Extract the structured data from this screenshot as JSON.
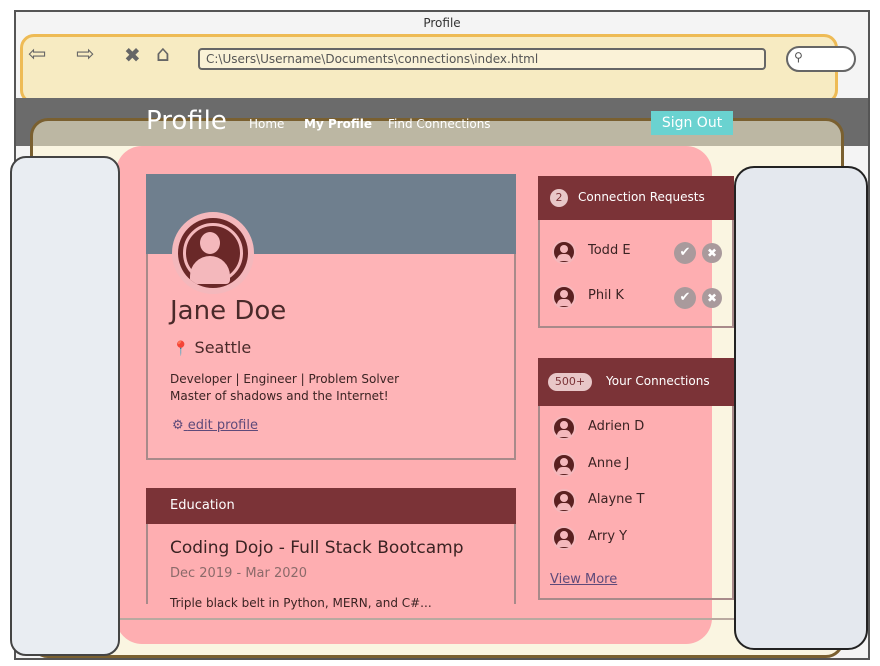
{
  "window": {
    "title": "Profile"
  },
  "browser": {
    "url": "C:\\Users\\Username\\Documents\\connections\\index.html",
    "search_icon": "magnifier-icon"
  },
  "navbar": {
    "brand": "Profile",
    "links": [
      "Home",
      "My Profile",
      "Find Connections"
    ],
    "sign_out": "Sign Out"
  },
  "profile": {
    "name": "Jane Doe",
    "location": "Seattle",
    "bio": [
      "Developer | Engineer | Problem Solver",
      "Master of shadows and the Internet!"
    ],
    "edit_link": "edit profile"
  },
  "education": {
    "header": "Education",
    "title": "Coding Dojo - Full Stack Bootcamp",
    "dates": "Dec 2019 - Mar 2020",
    "description": "Triple black belt in Python, MERN, and C#..."
  },
  "requests": {
    "count": "2",
    "title": "Connection Requests",
    "people": [
      "Todd E",
      "Phil K"
    ]
  },
  "connections": {
    "count": "500+",
    "title": "Your Connections",
    "people": [
      "Adrien D",
      "Anne J",
      "Alayne T",
      "Arry Y"
    ],
    "view_more": "View More"
  },
  "colors": {
    "accent": "#7b3337",
    "banner": "#6f7f8e",
    "signout": "#6ad2d0",
    "highlight_red": "#ff96a0",
    "highlight_yellow": "#f8e4a0"
  }
}
